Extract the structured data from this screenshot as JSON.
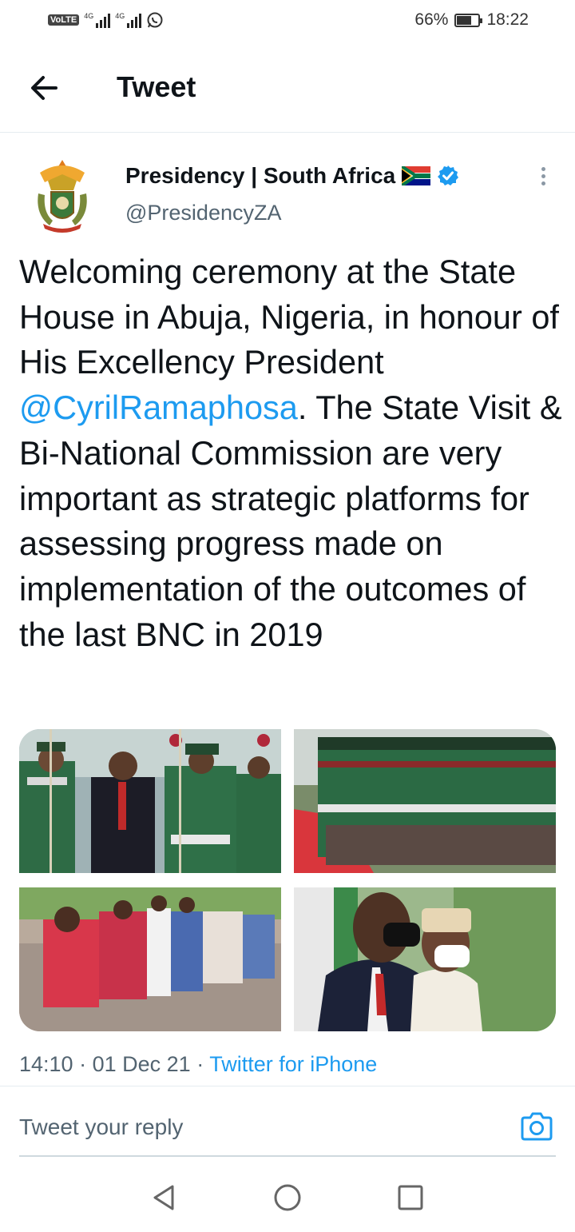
{
  "status_bar": {
    "volte": "VoLTE",
    "signal1_label": "4G",
    "signal2_label": "4G",
    "battery": "66%",
    "battery_level": 0.66,
    "time": "18:22",
    "icons": [
      "volte-icon",
      "signal-icon",
      "whatsapp-icon",
      "battery-icon"
    ]
  },
  "header": {
    "title": "Tweet",
    "back_icon": "arrow-left-icon"
  },
  "tweet": {
    "author_name": "Presidency | South Africa",
    "author_flag": "🇿🇦",
    "verified_icon": "verified-badge-icon",
    "handle": "@PresidencyZA",
    "more_icon": "more-vertical-icon",
    "text_before": "Welcoming ceremony at the State House in Abuja, Nigeria, in honour of His Excellency President ",
    "mention": "@CyrilRamaphosa",
    "text_after": ". The State Visit & Bi-National Commission are very important as strategic platforms for assessing progress made on implementation of the outcomes of the last BNC in 2019",
    "time": "14:10",
    "date": "01 Dec 21",
    "source": "Twitter for iPhone",
    "separator": "·"
  },
  "reply": {
    "placeholder": "Tweet your reply",
    "camera_icon": "camera-icon"
  },
  "nav": {
    "icons": [
      "back-triangle-icon",
      "home-circle-icon",
      "recents-square-icon"
    ]
  },
  "colors": {
    "accent": "#1d9bf0",
    "text": "#0f1419",
    "secondary": "#536471",
    "divider": "#e6ecf0"
  }
}
